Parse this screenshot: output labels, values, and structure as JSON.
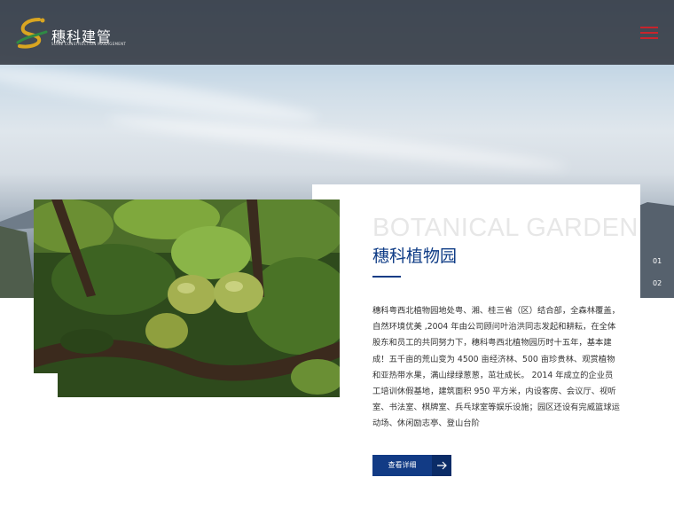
{
  "header": {
    "logo_text": "穗科建管",
    "logo_subtext": "SUIKE CONSTRUCTION MANAGEMENT",
    "menu_icon": "hamburger-icon"
  },
  "feature": {
    "title_en": "BOTANICAL GARDEN",
    "title_cn": "穗科植物园",
    "description": "穗科粤西北植物园地处粤、湘、桂三省（区）结合部，全森林覆盖，自然环境优美 ,2004 年由公司顾问叶治洪同志发起和耕耘，在全体股东和员工的共同努力下，穗科粤西北植物园历时十五年，基本建成！五千亩的荒山变为 4500 亩经济林、500 亩珍贵林、观赏植物和亚热带水果，满山绿绿葱葱，茁壮成长。 2014 年成立的企业员工培训休假基地，建筑面积 950 平方米，内设客房、会议厅、视听室、书法室、棋牌室、兵乓球室等娱乐设施；园区还设有完威篮球运动场、休闲励志亭、登山台阶",
    "button_label": "查看详细",
    "button_icon": "arrow-right-icon"
  },
  "slider": {
    "pages": [
      "01",
      "02"
    ]
  },
  "colors": {
    "brand_blue": "#123b85",
    "accent_red": "#c8242c",
    "header_bg": "#2c3038"
  }
}
